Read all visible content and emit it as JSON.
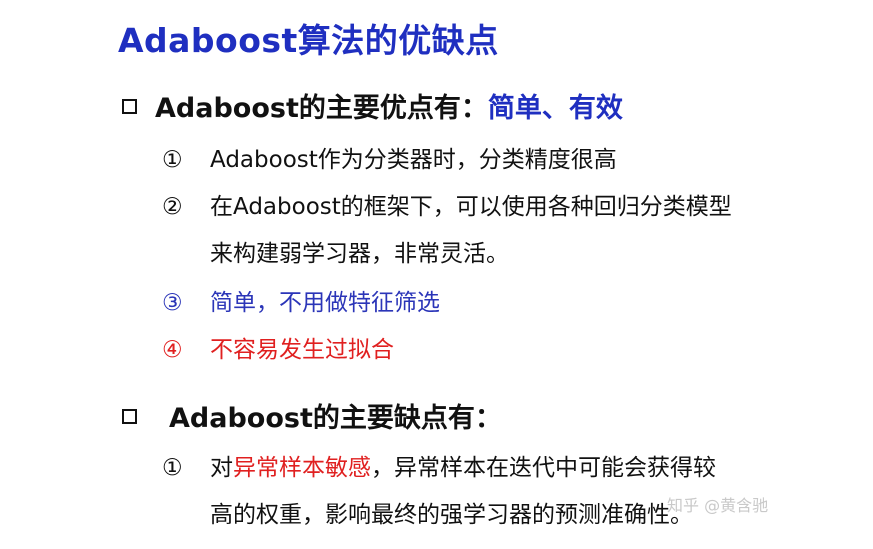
{
  "title": "Adaboost算法的优缺点",
  "advantages": {
    "heading": "Adaboost的主要优点有：",
    "heading_highlight": "简单、有效",
    "items": [
      {
        "num": "①",
        "text": "Adaboost作为分类器时，分类精度很高"
      },
      {
        "num": "②",
        "text": "在Adaboost的框架下，可以使用各种回归分类模型",
        "continuation": "来构建弱学习器，非常灵活。"
      },
      {
        "num": "③",
        "text": "简单，不用做特征筛选"
      },
      {
        "num": "④",
        "text": "不容易发生过拟合"
      }
    ]
  },
  "disadvantages": {
    "heading": "Adaboost的主要缺点有：",
    "items": [
      {
        "num": "①",
        "text_prefix": "对",
        "text_highlight": "异常样本敏感",
        "text_suffix": "，异常样本在迭代中可能会获得较",
        "continuation": "高的权重，影响最终的强学习器的预测准确性。"
      }
    ]
  },
  "watermark": "知乎 @黄含驰",
  "colors": {
    "title_blue": "#1f2fc0",
    "item_blue": "#2b35b8",
    "red": "#e02020",
    "text": "#111111"
  }
}
